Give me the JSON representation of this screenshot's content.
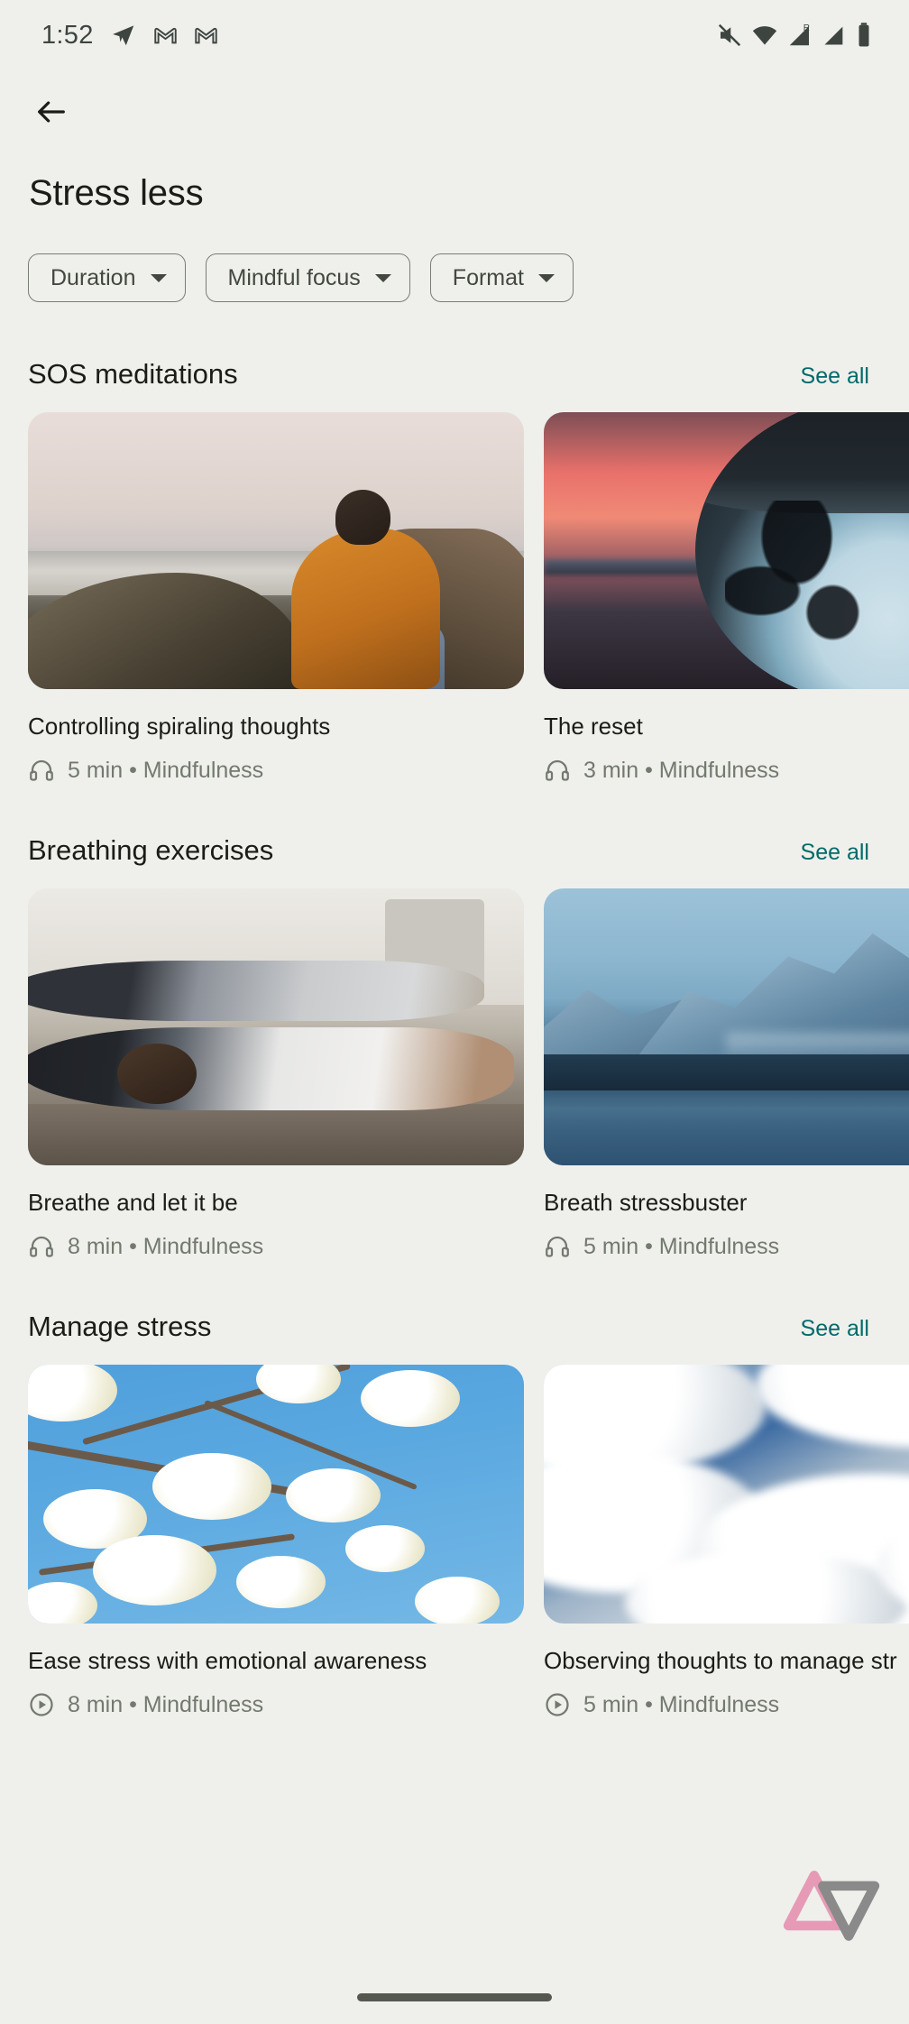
{
  "status_bar": {
    "time": "1:52",
    "left_icons": [
      "telegram-icon",
      "gmail-icon",
      "gmail-icon"
    ],
    "right_icons": [
      "mute-icon",
      "wifi-icon",
      "signal-roaming-icon",
      "signal-icon",
      "battery-icon"
    ],
    "roaming_label": "R"
  },
  "app_bar": {
    "back_icon": "back-arrow-icon",
    "title": "Stress less"
  },
  "filters": {
    "chips": [
      {
        "label": "Duration",
        "icon": "chevron-down-icon"
      },
      {
        "label": "Mindful focus",
        "icon": "chevron-down-icon"
      },
      {
        "label": "Format",
        "icon": "chevron-down-icon"
      }
    ]
  },
  "accent_color": "#006a6a",
  "background_color": "#eff0ec",
  "sections": [
    {
      "title": "SOS meditations",
      "see_all": "See all",
      "cards": [
        {
          "title": "Controlling spiraling thoughts",
          "meta": "5 min • Mindfulness",
          "duration": "5 min",
          "category": "Mindfulness",
          "media_icon": "headphones-icon",
          "image_alt": "woman-sitting-on-rocky-coast-at-dusk"
        },
        {
          "title": "The reset",
          "meta": "3 min • Mindfulness",
          "duration": "3 min",
          "category": "Mindfulness",
          "media_icon": "headphones-icon",
          "image_alt": "glass-sphere-sunset-reflection"
        }
      ]
    },
    {
      "title": "Breathing exercises",
      "see_all": "See all",
      "cards": [
        {
          "title": "Breathe and let it be",
          "meta": "8 min • Mindfulness",
          "duration": "8 min",
          "category": "Mindfulness",
          "media_icon": "headphones-icon",
          "image_alt": "people-lying-on-yoga-mats"
        },
        {
          "title": "Breath stressbuster",
          "meta": "5 min • Mindfulness",
          "duration": "5 min",
          "category": "Mindfulness",
          "media_icon": "headphones-icon",
          "image_alt": "blue-mountain-lake"
        }
      ]
    },
    {
      "title": "Manage stress",
      "see_all": "See all",
      "cards": [
        {
          "title": "Ease stress with emotional awareness",
          "meta": "8 min • Mindfulness",
          "duration": "8 min",
          "category": "Mindfulness",
          "media_icon": "play-circle-icon",
          "image_alt": "white-blossoms-against-blue-sky"
        },
        {
          "title": "Observing thoughts to manage str",
          "meta": "5 min • Mindfulness",
          "duration": "5 min",
          "category": "Mindfulness",
          "media_icon": "play-circle-icon",
          "image_alt": "clouds-in-sky"
        }
      ]
    }
  ],
  "watermark": {
    "icon": "dual-triangle-logo",
    "colors": [
      "#e79ab5",
      "#8a8a8a"
    ]
  },
  "nav_bar": {
    "home_indicator": "home-indicator"
  }
}
